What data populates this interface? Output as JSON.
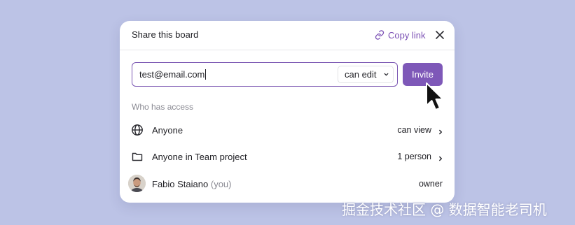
{
  "colors": {
    "background": "#bcc3e6",
    "accent": "#7e58b8",
    "link": "#7a4fb4",
    "muted": "#8a8a93"
  },
  "dialog": {
    "title": "Share this board",
    "copy_link_label": "Copy link",
    "copy_link_icon": "link-icon",
    "close_icon": "close-icon"
  },
  "invite": {
    "email_value": "test@email.com",
    "permission_selected": "can edit",
    "button_label": "Invite"
  },
  "access": {
    "section_label": "Who has access",
    "rows": [
      {
        "icon": "globe-icon",
        "name": "Anyone",
        "suffix": "",
        "permission": "can view",
        "has_chevron": true
      },
      {
        "icon": "folder-icon",
        "name": "Anyone in Team project",
        "suffix": "",
        "permission": "1 person",
        "has_chevron": true
      },
      {
        "icon": "avatar",
        "name": "Fabio Staiano",
        "suffix": "(you)",
        "permission": "owner",
        "has_chevron": false
      }
    ]
  },
  "watermark": "掘金技术社区 @ 数据智能老司机"
}
